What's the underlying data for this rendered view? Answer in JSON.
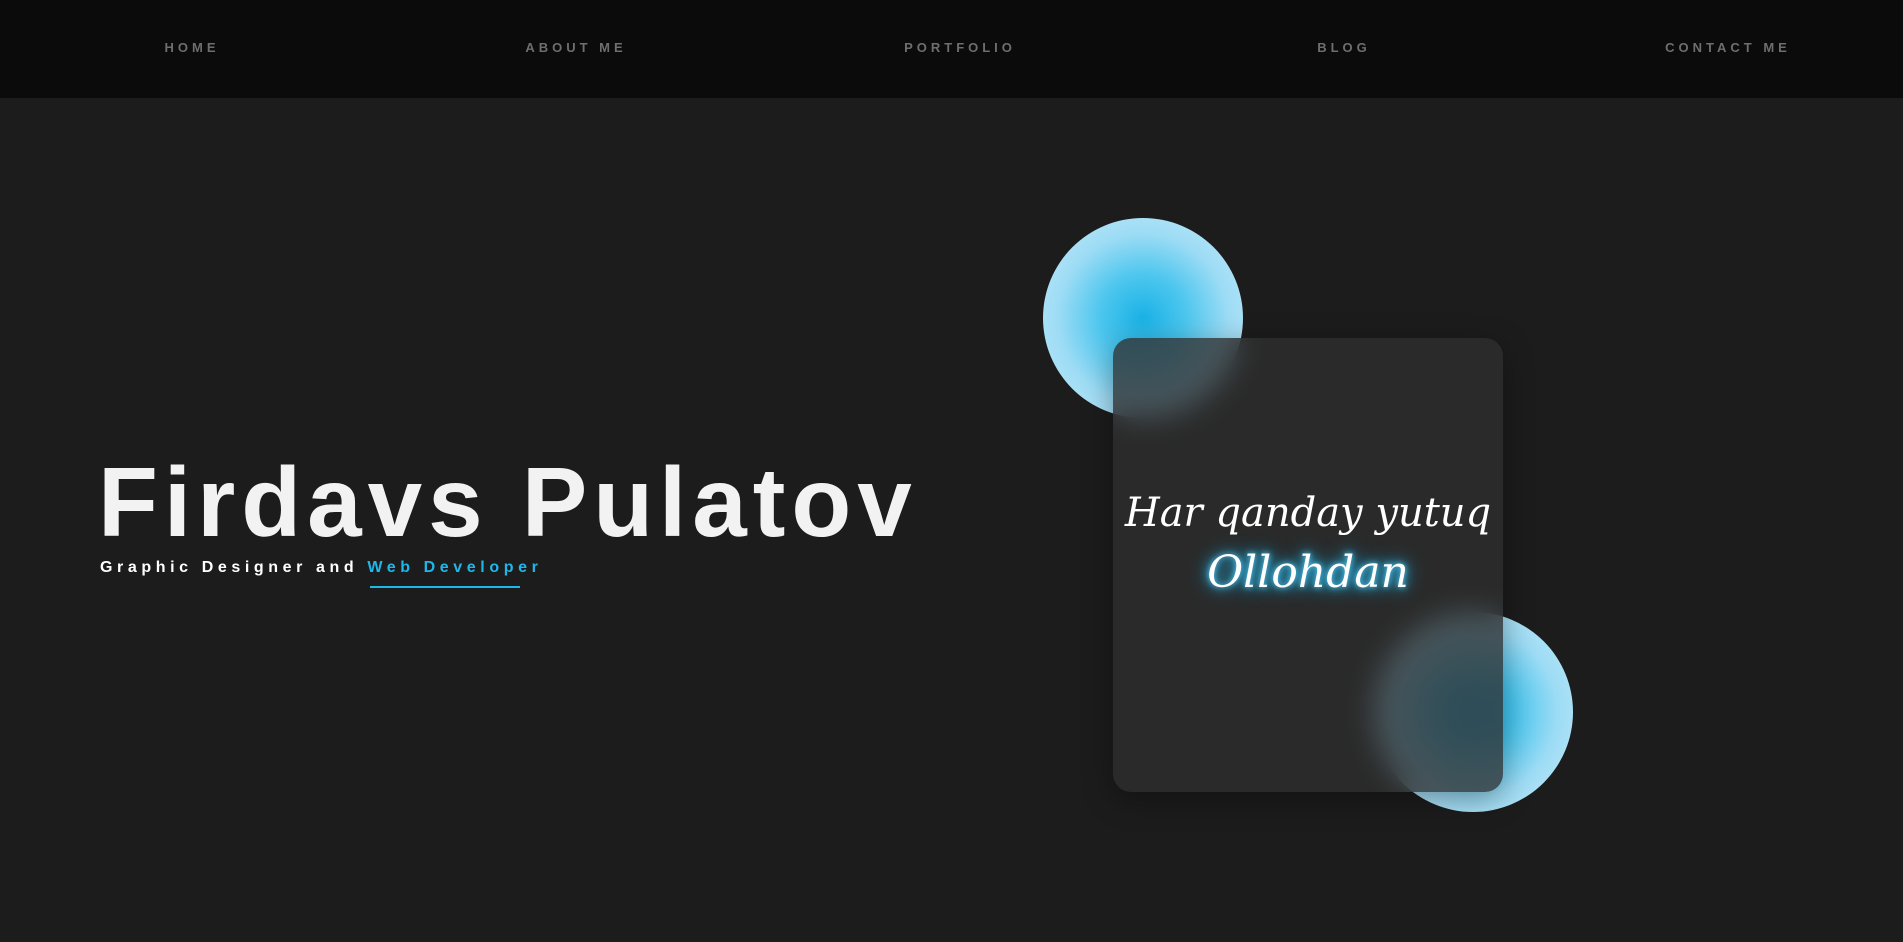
{
  "nav": {
    "items": [
      {
        "label": "HOME"
      },
      {
        "label": "ABOUT ME"
      },
      {
        "label": "PORTFOLIO"
      },
      {
        "label": "BLOG"
      },
      {
        "label": "CONTACT ME"
      }
    ]
  },
  "hero": {
    "name": "Firdavs Pulatov",
    "subtitle_prefix": "Graphic Designer and ",
    "subtitle_accent": "Web Developer"
  },
  "card": {
    "quote_line1": "Har qanday yutuq",
    "quote_line2": "Ollohdan"
  },
  "colors": {
    "accent": "#1fb6ea",
    "background": "#1c1c1c",
    "nav_background": "#0b0b0b"
  }
}
